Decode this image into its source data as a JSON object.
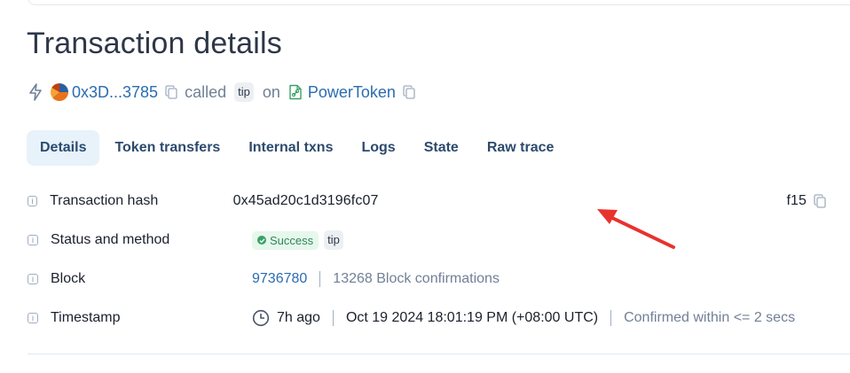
{
  "page": {
    "title": "Transaction details"
  },
  "tx_summary": {
    "from_address": "0x3D...3785",
    "called_text": "called",
    "method_tag": "tip",
    "on_text": "on",
    "contract_name": "PowerToken"
  },
  "tabs": [
    {
      "label": "Details",
      "active": true
    },
    {
      "label": "Token transfers"
    },
    {
      "label": "Internal txns"
    },
    {
      "label": "Logs"
    },
    {
      "label": "State"
    },
    {
      "label": "Raw trace"
    }
  ],
  "details": {
    "hash": {
      "label": "Transaction hash",
      "prefix": "0x45ad20c1d3196fc07",
      "suffix": "f15"
    },
    "status": {
      "label": "Status and method",
      "status": "Success",
      "method": "tip"
    },
    "block": {
      "label": "Block",
      "number": "9736780",
      "confirmations": "13268 Block confirmations"
    },
    "timestamp": {
      "label": "Timestamp",
      "relative": "7h ago",
      "absolute": "Oct 19 2024 18:01:19 PM (+08:00 UTC)",
      "confirmed": "Confirmed within <= 2 secs"
    }
  },
  "colors": {
    "link": "#2b6cb0",
    "success": "#38a169",
    "annotation_arrow": "#e8322e",
    "active_tab_bg": "#e7f2fb"
  },
  "icons": [
    "bolt-icon",
    "avatar-icon",
    "copy-icon",
    "contract-icon",
    "info-icon",
    "check-icon",
    "clock-icon",
    "arrow-annotation"
  ]
}
